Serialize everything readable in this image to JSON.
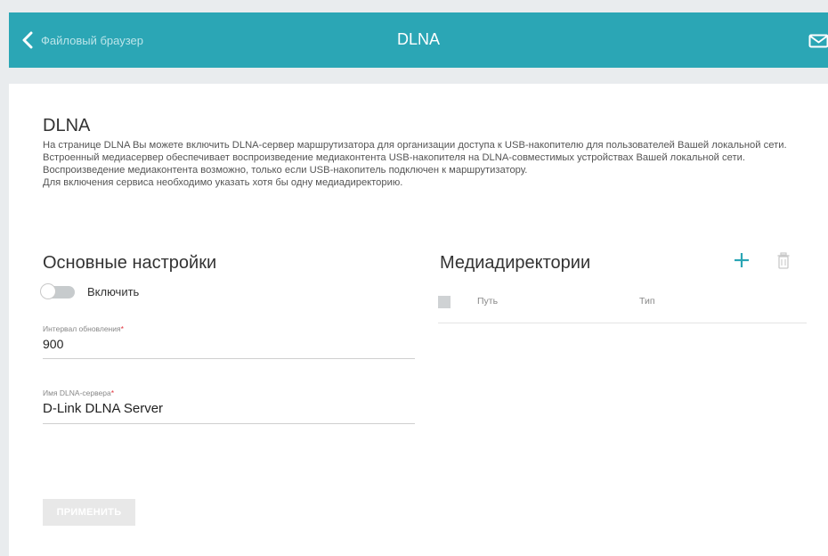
{
  "header": {
    "back_label": "Файловый браузер",
    "title": "DLNA",
    "bar_color": "#2ba6b5",
    "mail_icon": "mail-icon"
  },
  "main": {
    "title": "DLNA",
    "description": [
      "На странице DLNA Вы можете включить DLNA-сервер маршрутизатора для организации доступа к USB-накопителю для пользователей Вашей локальной сети.",
      "Встроенный медиасервер обеспечивает воспроизведение медиаконтента USB-накопителя на DLNA-совместимых устройствах Вашей локальной сети. Воспроизведение медиаконтента возможно, только если USB-накопитель подключен к маршрутизатору.",
      "Для включения сервиса необходимо указать хотя бы одну медиадиректорию."
    ]
  },
  "settings": {
    "title": "Основные настройки",
    "enable_label": "Включить",
    "enable_state": false,
    "refresh_label": "Интервал обновления",
    "refresh_value": "900",
    "server_name_label": "Имя DLNA-сервера",
    "server_name_value": "D-Link DLNA Server",
    "required_mark": "*",
    "apply_label": "ПРИМЕНИТЬ"
  },
  "media": {
    "title": "Медиадиректории",
    "add_icon": "plus-icon",
    "delete_icon": "trash-icon",
    "columns": [
      "Путь",
      "Тип"
    ],
    "accent": "#2ba6b5"
  }
}
